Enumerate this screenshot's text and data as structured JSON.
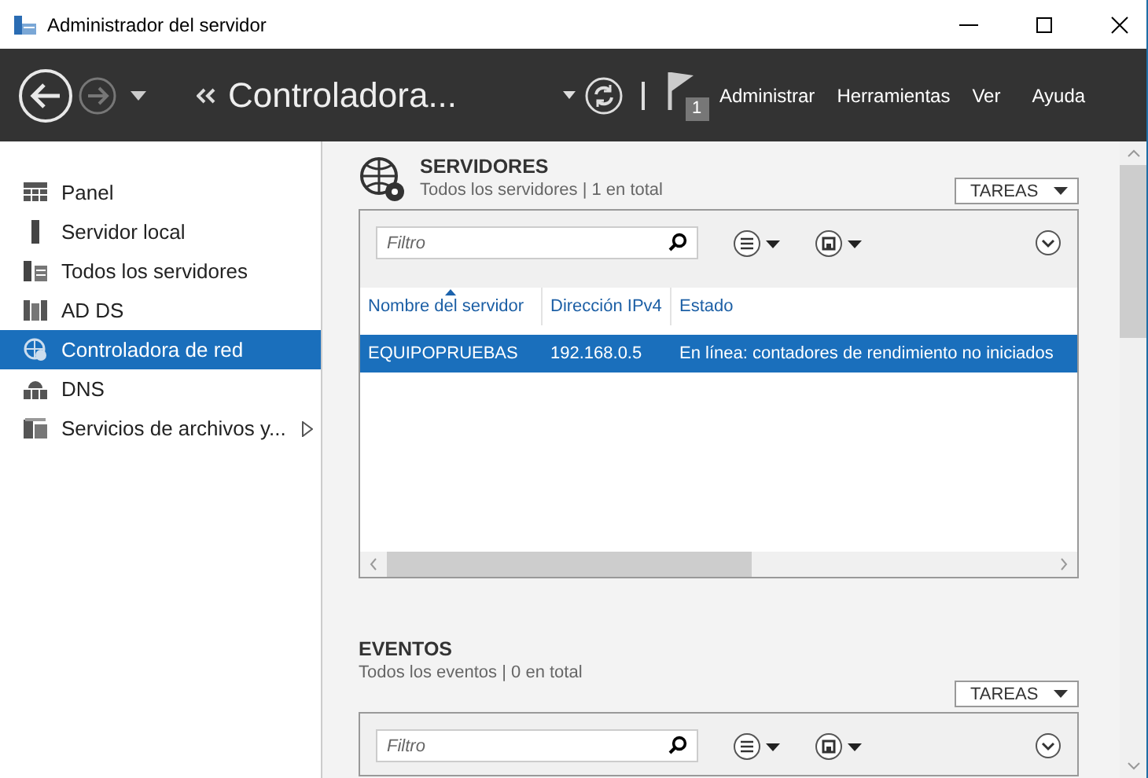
{
  "window": {
    "title": "Administrador del servidor"
  },
  "toolbar": {
    "breadcrumb": "Controladora...",
    "notification_count": "1",
    "menus": [
      "Administrar",
      "Herramientas",
      "Ver",
      "Ayuda"
    ]
  },
  "sidebar": {
    "items": [
      {
        "label": "Panel",
        "kind": "dashboard",
        "selected": false,
        "has_submenu": false
      },
      {
        "label": "Servidor local",
        "kind": "server",
        "selected": false,
        "has_submenu": false
      },
      {
        "label": "Todos los servidores",
        "kind": "servers",
        "selected": false,
        "has_submenu": false
      },
      {
        "label": "AD DS",
        "kind": "directory",
        "selected": false,
        "has_submenu": false
      },
      {
        "label": "Controladora de red",
        "kind": "network",
        "selected": true,
        "has_submenu": false
      },
      {
        "label": "DNS",
        "kind": "dns",
        "selected": false,
        "has_submenu": false
      },
      {
        "label": "Servicios de archivos y...",
        "kind": "files",
        "selected": false,
        "has_submenu": true
      }
    ]
  },
  "sections": [
    {
      "title": "SERVIDORES",
      "subtitle": "Todos los servidores | 1 en total",
      "tasks_label": "TAREAS",
      "filter_placeholder": "Filtro",
      "table": {
        "columns": [
          {
            "label": "Nombre del servidor",
            "sorted": true
          },
          {
            "label": "Dirección IPv4",
            "sorted": false
          },
          {
            "label": "Estado",
            "sorted": false
          }
        ],
        "rows": [
          {
            "cells": [
              "EQUIPOPRUEBAS",
              "192.168.0.5",
              "En línea: contadores de rendimiento no iniciados"
            ],
            "selected": true
          }
        ]
      }
    },
    {
      "title": "EVENTOS",
      "subtitle": "Todos los eventos | 0 en total",
      "tasks_label": "TAREAS",
      "filter_placeholder": "Filtro"
    }
  ]
}
